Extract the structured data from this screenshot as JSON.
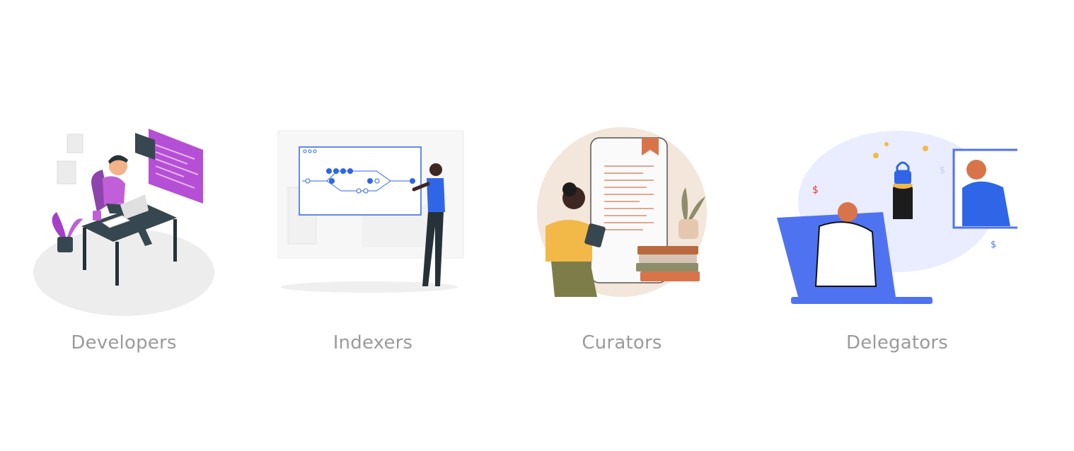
{
  "roles": [
    {
      "label": "Developers",
      "illustration": "developer-at-desk"
    },
    {
      "label": "Indexers",
      "illustration": "indexer-at-whiteboard"
    },
    {
      "label": "Curators",
      "illustration": "curator-with-tablet-and-books"
    },
    {
      "label": "Delegators",
      "illustration": "delegators-exchanging-coins"
    }
  ],
  "colors": {
    "label": "#9a9a9a",
    "accent_purple": "#b44fd6",
    "accent_blue": "#2f66e8",
    "accent_orange": "#d9744a"
  }
}
